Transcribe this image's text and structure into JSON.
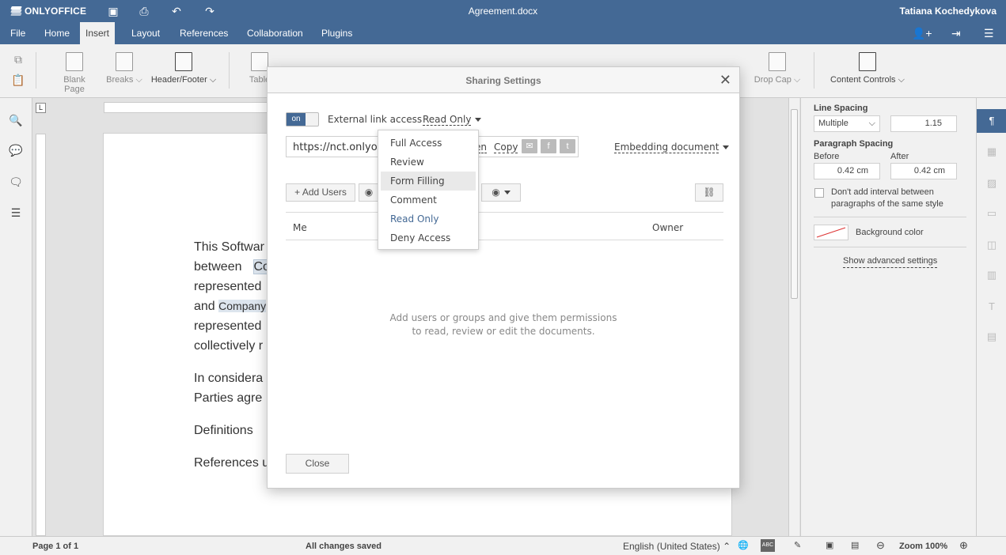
{
  "app": {
    "brand": "ONLYOFFICE",
    "doc_title": "Agreement.docx",
    "user": "Tatiana Kochedykova"
  },
  "menu": {
    "tabs": [
      "File",
      "Home",
      "Insert",
      "Layout",
      "References",
      "Collaboration",
      "Plugins"
    ],
    "active_tab": "Insert"
  },
  "toolbar": {
    "blank_page": "Blank Page",
    "breaks": "Breaks",
    "header_footer": "Header/Footer",
    "table": "Table",
    "drop_cap": "Drop Cap",
    "content_controls": "Content Controls"
  },
  "document": {
    "lines": [
      "This Softwar",
      "between",
      "represented",
      "and",
      "represented",
      "collectively r",
      "In considera",
      "Parties agre",
      "Definitions",
      "References u"
    ],
    "highlight_1": "Co",
    "highlight_2": "Company"
  },
  "right_panel": {
    "line_spacing_label": "Line Spacing",
    "line_spacing_type": "Multiple",
    "line_spacing_value": "1.15",
    "paragraph_spacing_label": "Paragraph Spacing",
    "before_label": "Before",
    "after_label": "After",
    "before_value": "0.42 cm",
    "after_value": "0.42 cm",
    "no_interval_text": "Don't add interval between paragraphs of the same style",
    "background_color_label": "Background color",
    "advanced_link": "Show advanced settings"
  },
  "statusbar": {
    "page_info": "Page 1 of 1",
    "save_status": "All changes saved",
    "language": "English (United States)",
    "zoom": "Zoom 100%"
  },
  "dialog": {
    "title": "Sharing Settings",
    "toggle_label": "on",
    "external_link_label": "External link access",
    "access_value": "Read Only",
    "url": "https://nct.onlyo",
    "open_label": "en",
    "copy_label": "Copy",
    "embedding_label": "Embedding document",
    "add_users_label": "Add Users",
    "column_me": "Me",
    "column_owner": "Owner",
    "empty_line_1": "Add users or groups and give them permissions",
    "empty_line_2": "to read, review or edit the documents.",
    "close_button": "Close"
  },
  "access_dropdown": {
    "options": [
      "Full Access",
      "Review",
      "Form Filling",
      "Comment",
      "Read Only",
      "Deny Access"
    ],
    "hovered": "Form Filling",
    "selected": "Read Only"
  },
  "colors": {
    "header_blue": "#446995",
    "selected_text": "#446995"
  }
}
